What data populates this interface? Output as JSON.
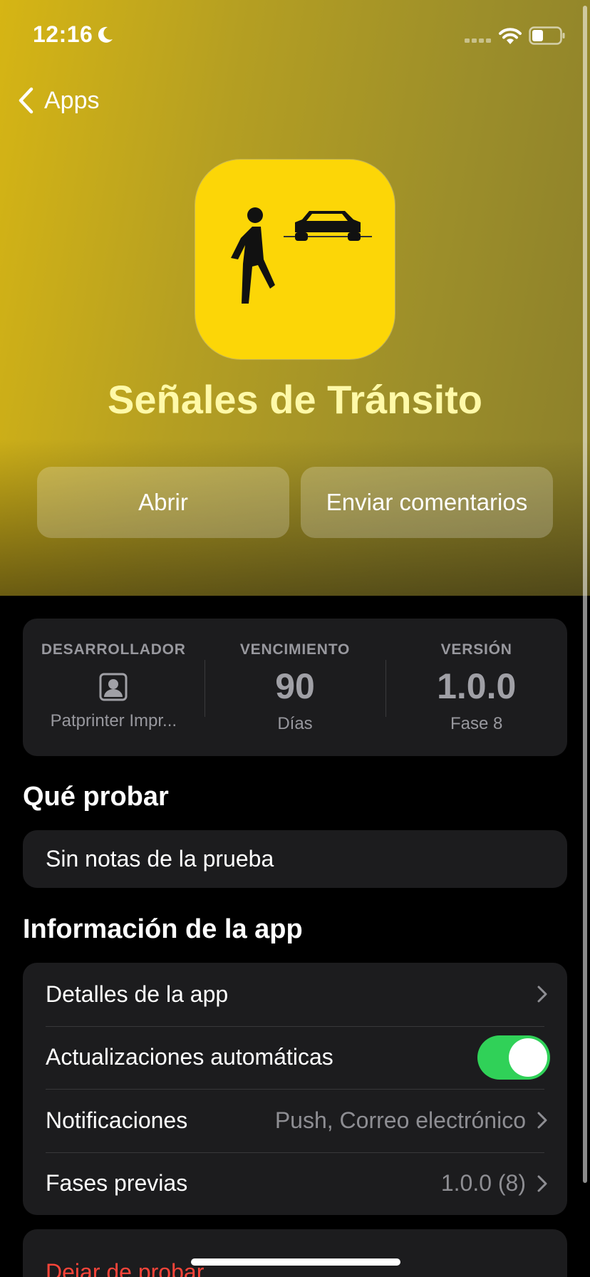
{
  "status_bar": {
    "time": "12:16",
    "moon_icon": "moon-icon",
    "signal_icon": "cellular-signal-icon",
    "wifi_icon": "wifi-icon",
    "battery_icon": "battery-icon"
  },
  "nav": {
    "back_label": "Apps",
    "back_icon": "chevron-left-icon"
  },
  "app": {
    "icon": "pedestrian-car-app-icon",
    "icon_color": "#fcd607",
    "title": "Señales de Tránsito",
    "title_color": "#fff9a8"
  },
  "actions": {
    "open_label": "Abrir",
    "feedback_label": "Enviar comentarios"
  },
  "info": {
    "developer": {
      "label": "DESARROLLADOR",
      "icon": "person-badge-icon",
      "value": "Patprinter Impr..."
    },
    "expiration": {
      "label": "VENCIMIENTO",
      "value": "90",
      "sub": "Días"
    },
    "version": {
      "label": "VERSIÓN",
      "value": "1.0.0",
      "sub": "Fase 8"
    }
  },
  "what_to_test": {
    "title": "Qué probar",
    "notes": "Sin notas de la prueba"
  },
  "app_info": {
    "title": "Información de la app",
    "rows": [
      {
        "label": "Detalles de la app",
        "value": ""
      },
      {
        "label": "Actualizaciones automáticas",
        "toggle": true
      },
      {
        "label": "Notificaciones",
        "value": "Push, Correo electrónico"
      },
      {
        "label": "Fases previas",
        "value": "1.0.0 (8)"
      }
    ]
  },
  "stop_testing": {
    "label": "Dejar de probar",
    "color": "#ff453a"
  },
  "colors": {
    "toggle_on": "#30d158",
    "card_bg": "#1c1c1e"
  }
}
